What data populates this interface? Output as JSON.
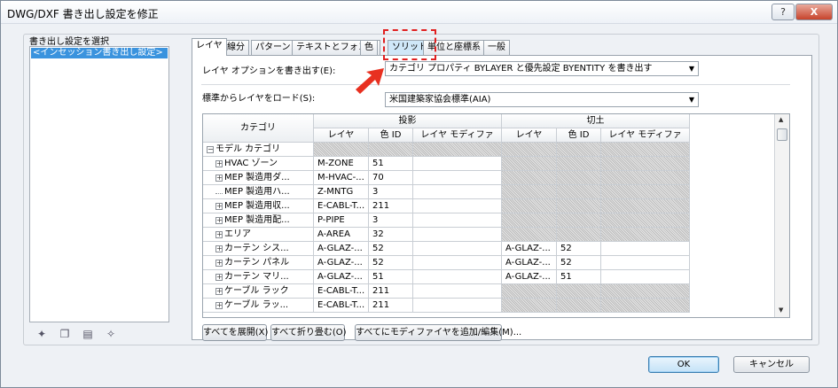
{
  "window": {
    "title": "DWG/DXF 書き出し設定を修正",
    "help": "?",
    "close": "X"
  },
  "left": {
    "label": "書き出し設定を選択",
    "selected_item": "<インセッション書き出し設定>"
  },
  "tabs": [
    "レイヤ",
    "線分",
    "パターン",
    "テキストとフォント",
    "色",
    "ソリッド",
    "単位と座標系",
    "一般"
  ],
  "layer_options": {
    "label": "レイヤ オプションを書き出す(E):",
    "value": "カテゴリ プロパティ BYLAYER と優先設定 BYENTITY を書き出す"
  },
  "layer_standard": {
    "label": "標準からレイヤをロード(S):",
    "value": "米国建築家協会標準(AIA)"
  },
  "grid": {
    "header_category": "カテゴリ",
    "group_projection": "投影",
    "group_cut": "切土",
    "col_layer": "レイヤ",
    "col_color_id": "色 ID",
    "col_modifier": "レイヤ モディファ",
    "rows": [
      {
        "category": "モデル カテゴリ",
        "sign": "⊟",
        "level": 0,
        "p_layer": "",
        "p_color": "",
        "c_layer": "",
        "c_color": "",
        "p_hatch": true,
        "c_hatch": true
      },
      {
        "category": "HVAC ゾーン",
        "sign": "⊞",
        "level": 1,
        "p_layer": "M-ZONE",
        "p_color": "51",
        "c_layer": "",
        "c_color": "",
        "p_hatch": false,
        "c_hatch": true
      },
      {
        "category": "MEP 製造用ダ...",
        "sign": "⊞",
        "level": 1,
        "p_layer": "M-HVAC-...",
        "p_color": "70",
        "c_layer": "",
        "c_color": "",
        "p_hatch": false,
        "c_hatch": true
      },
      {
        "category": "MEP 製造用ハ...",
        "sign": "",
        "level": 1,
        "p_layer": "Z-MNTG",
        "p_color": "3",
        "c_layer": "",
        "c_color": "",
        "p_hatch": false,
        "c_hatch": true
      },
      {
        "category": "MEP 製造用収...",
        "sign": "⊞",
        "level": 1,
        "p_layer": "E-CABL-T...",
        "p_color": "211",
        "c_layer": "",
        "c_color": "",
        "p_hatch": false,
        "c_hatch": true
      },
      {
        "category": "MEP 製造用配...",
        "sign": "⊞",
        "level": 1,
        "p_layer": "P-PIPE",
        "p_color": "3",
        "c_layer": "",
        "c_color": "",
        "p_hatch": false,
        "c_hatch": true
      },
      {
        "category": "エリア",
        "sign": "⊞",
        "level": 1,
        "p_layer": "A-AREA",
        "p_color": "32",
        "c_layer": "",
        "c_color": "",
        "p_hatch": false,
        "c_hatch": true
      },
      {
        "category": "カーテン シス...",
        "sign": "⊞",
        "level": 1,
        "p_layer": "A-GLAZ-...",
        "p_color": "52",
        "c_layer": "A-GLAZ-...",
        "c_color": "52",
        "p_hatch": false,
        "c_hatch": false
      },
      {
        "category": "カーテン パネル",
        "sign": "⊞",
        "level": 1,
        "p_layer": "A-GLAZ-...",
        "p_color": "52",
        "c_layer": "A-GLAZ-...",
        "c_color": "52",
        "p_hatch": false,
        "c_hatch": false
      },
      {
        "category": "カーテン マリ...",
        "sign": "⊞",
        "level": 1,
        "p_layer": "A-GLAZ-...",
        "p_color": "51",
        "c_layer": "A-GLAZ-...",
        "c_color": "51",
        "p_hatch": false,
        "c_hatch": false
      },
      {
        "category": "ケーブル ラック",
        "sign": "⊞",
        "level": 1,
        "p_layer": "E-CABL-T...",
        "p_color": "211",
        "c_layer": "",
        "c_color": "",
        "p_hatch": false,
        "c_hatch": true
      },
      {
        "category": "ケーブル ラッ...",
        "sign": "⊞",
        "level": 1,
        "p_layer": "E-CABL-T...",
        "p_color": "211",
        "c_layer": "",
        "c_color": "",
        "p_hatch": false,
        "c_hatch": true
      }
    ]
  },
  "buttons": {
    "expand_all": "すべてを展開(X)",
    "collapse_all": "すべて折り畳む(O)",
    "add_modifiers": "すべてにモディファイヤを追加/編集(M)...",
    "ok": "OK",
    "cancel": "キャンセル"
  },
  "colors": {
    "selection": "#3a93de",
    "highlight_box": "#e02020",
    "arrow": "#e83020"
  }
}
